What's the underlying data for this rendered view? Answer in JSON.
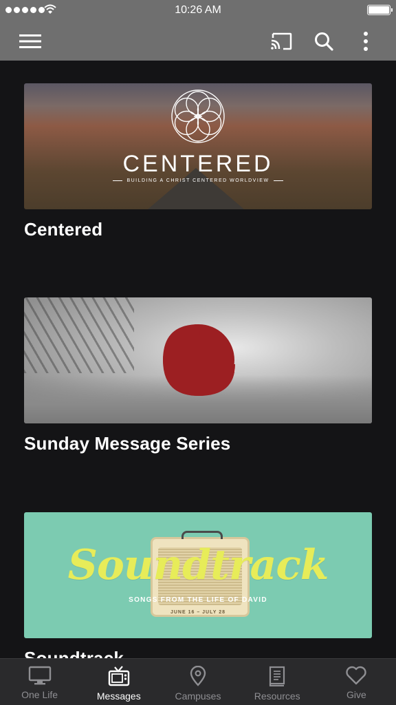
{
  "status_bar": {
    "time": "10:26 AM",
    "signal_icon": "signal-dots-icon",
    "wifi_icon": "wifi-icon",
    "battery_icon": "battery-icon"
  },
  "nav_bar": {
    "menu_icon": "hamburger-menu-icon",
    "cast_icon": "cast-icon",
    "search_icon": "search-icon",
    "more_icon": "more-vertical-icon",
    "background": "#6f6f6f"
  },
  "series": [
    {
      "title": "Centered",
      "thumbnail": {
        "brand": "CENTERED",
        "tagline": "BUILDING A CHRIST CENTERED WORLDVIEW"
      }
    },
    {
      "title": "Sunday Message Series",
      "thumbnail": {
        "logo_color": "#9c1f22"
      }
    },
    {
      "title": "Soundtrack",
      "thumbnail": {
        "script": "Soundtrack",
        "subtitle": "SONGS FROM THE LIFE OF DAVID",
        "dates": "JUNE 16 – JULY 28"
      }
    }
  ],
  "tab_bar": {
    "active": "Messages",
    "tabs": [
      {
        "label": "One Life",
        "icon": "monitor-icon"
      },
      {
        "label": "Messages",
        "icon": "tv-icon"
      },
      {
        "label": "Campuses",
        "icon": "location-pin-icon"
      },
      {
        "label": "Resources",
        "icon": "book-icon"
      },
      {
        "label": "Give",
        "icon": "heart-icon"
      }
    ]
  },
  "colors": {
    "background": "#141416",
    "tab_inactive": "#8f8f93",
    "tab_active": "#ffffff",
    "soundtrack_bg": "#7ccbb1",
    "soundtrack_script": "#e7ec59"
  }
}
